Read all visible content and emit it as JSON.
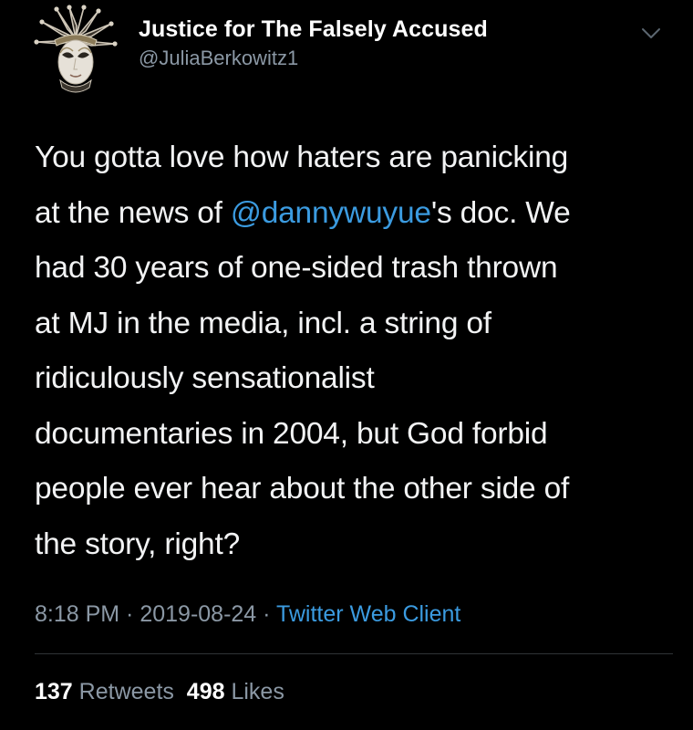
{
  "author": {
    "display_name": "Justice for The Falsely Accused",
    "handle": "@JuliaBerkowitz1",
    "avatar_icon": "jester-mask-icon"
  },
  "menu_icon": "chevron-down-icon",
  "tweet": {
    "text_before_mention": "You gotta love how haters are panicking\nat the news of ",
    "mention": "@dannywuyue",
    "text_after_mention": "'s doc. We\nhad 30 years of one-sided trash thrown\nat MJ in the media, incl. a string of\nridiculously sensationalist\ndocumentaries in 2004, but God forbid\npeople ever hear about the other side of\nthe story, right?"
  },
  "meta": {
    "time": "8:18 PM",
    "separator": " · ",
    "date": "2019-08-24",
    "client": "Twitter Web Client"
  },
  "stats": {
    "retweets_count": "137",
    "retweets_label": "Retweets",
    "likes_count": "498",
    "likes_label": "Likes"
  },
  "colors": {
    "background": "#000000",
    "link": "#3b9be0",
    "secondary_text": "#8b98a5",
    "divider": "#2f3336"
  }
}
